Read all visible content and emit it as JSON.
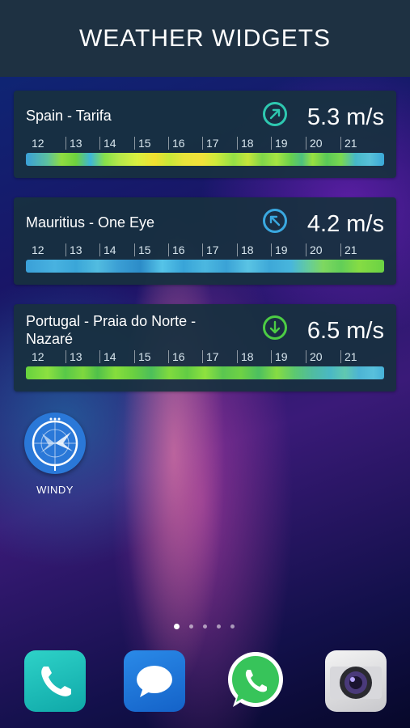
{
  "header": {
    "title": "WEATHER WIDGETS"
  },
  "hour_labels": [
    "12",
    "13",
    "14",
    "15",
    "16",
    "17",
    "18",
    "19",
    "20",
    "21"
  ],
  "widgets": [
    {
      "location": "Spain - Tarifa",
      "speed": "5.3 m/s",
      "direction_icon": "arrow-up-right-icon",
      "icon_color": "#2ec8b0"
    },
    {
      "location": "Mauritius - One Eye",
      "speed": "4.2 m/s",
      "direction_icon": "arrow-up-left-icon",
      "icon_color": "#3aa8e0"
    },
    {
      "location": "Portugal - Praia do Norte - Nazaré",
      "speed": "6.5 m/s",
      "direction_icon": "arrow-down-icon",
      "icon_color": "#4ccc44"
    }
  ],
  "home_app": {
    "label": "WINDY",
    "icon": "windy-radar-icon",
    "color": "#2a78d8"
  },
  "page_indicator": {
    "pages": 5,
    "active": 1
  },
  "dock": [
    {
      "name": "phone",
      "icon": "phone-icon"
    },
    {
      "name": "messages",
      "icon": "message-icon"
    },
    {
      "name": "whatsapp",
      "icon": "whatsapp-icon"
    },
    {
      "name": "camera",
      "icon": "camera-icon"
    }
  ]
}
